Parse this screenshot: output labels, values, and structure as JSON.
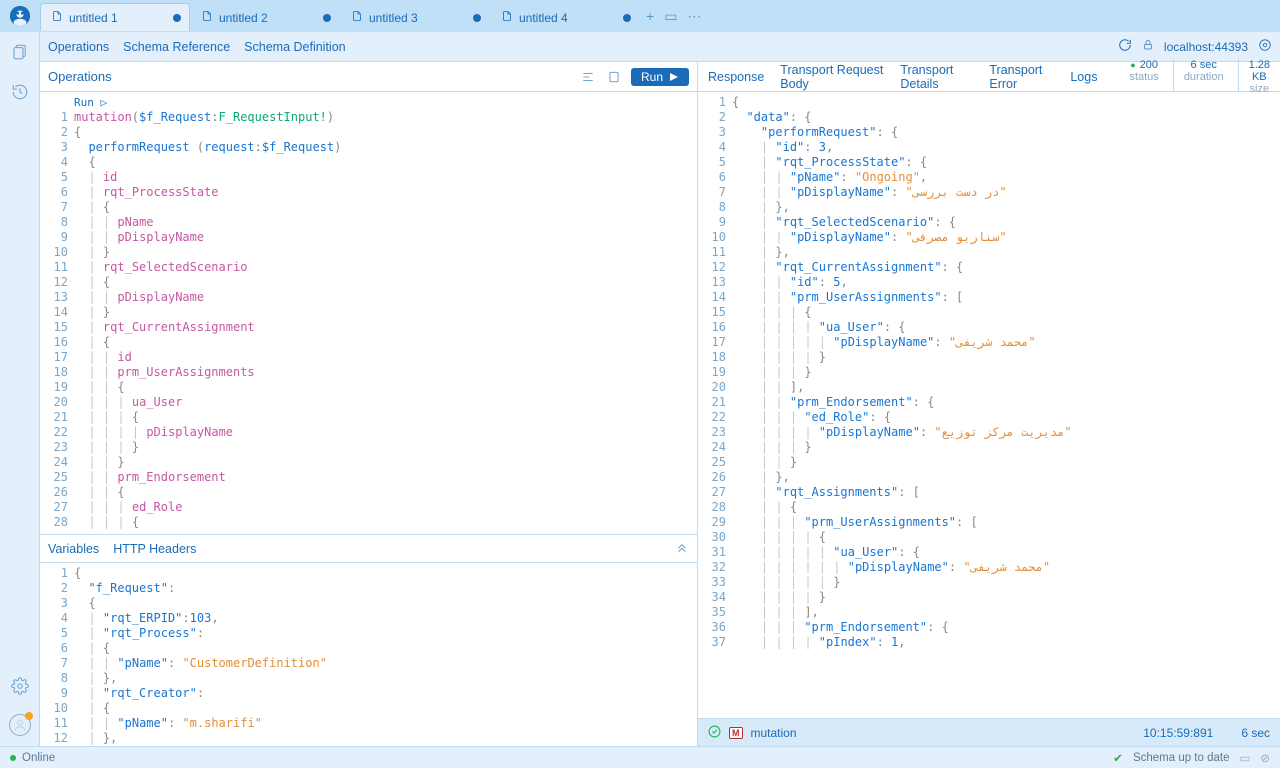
{
  "tabs": [
    {
      "label": "untitled 1",
      "active": true
    },
    {
      "label": "untitled 2",
      "active": false
    },
    {
      "label": "untitled 3",
      "active": false
    },
    {
      "label": "untitled 4",
      "active": false
    }
  ],
  "schemaBar": {
    "items": [
      "Operations",
      "Schema Reference",
      "Schema Definition"
    ],
    "url": "localhost:44393"
  },
  "ops": {
    "title": "Operations",
    "runLabel": "Run",
    "runHint": "Run ▷",
    "code_lines": [
      {
        "html": "<span class='kw'>mutation</span><span class='punct'>(</span><span class='field'>$f_Request</span><span class='punct'>:</span><span class='type'>F_RequestInput!</span><span class='punct'>)</span>"
      },
      {
        "html": "<span class='punct'>{</span>"
      },
      {
        "html": "  <span class='field'>performRequest</span> <span class='punct'>(</span><span class='field'>request</span><span class='punct'>:</span><span class='field'>$f_Request</span><span class='punct'>)</span>"
      },
      {
        "html": "  <span class='punct'>{</span>"
      },
      {
        "html": "  <span class='bar'>|</span> <span class='prop'>id</span>"
      },
      {
        "html": "  <span class='bar'>|</span> <span class='prop'>rqt_ProcessState</span>"
      },
      {
        "html": "  <span class='bar'>|</span> <span class='punct'>{</span>"
      },
      {
        "html": "  <span class='bar'>|</span> <span class='bar'>|</span> <span class='prop'>pName</span>"
      },
      {
        "html": "  <span class='bar'>|</span> <span class='bar'>|</span> <span class='prop'>pDisplayName</span>"
      },
      {
        "html": "  <span class='bar'>|</span> <span class='punct'>}</span>"
      },
      {
        "html": "  <span class='bar'>|</span> <span class='prop'>rqt_SelectedScenario</span>"
      },
      {
        "html": "  <span class='bar'>|</span> <span class='punct'>{</span>"
      },
      {
        "html": "  <span class='bar'>|</span> <span class='bar'>|</span> <span class='prop'>pDisplayName</span>"
      },
      {
        "html": "  <span class='bar'>|</span> <span class='punct'>}</span>"
      },
      {
        "html": "  <span class='bar'>|</span> <span class='prop'>rqt_CurrentAssignment</span>"
      },
      {
        "html": "  <span class='bar'>|</span> <span class='punct'>{</span>"
      },
      {
        "html": "  <span class='bar'>|</span> <span class='bar'>|</span> <span class='prop'>id</span>"
      },
      {
        "html": "  <span class='bar'>|</span> <span class='bar'>|</span> <span class='prop'>prm_UserAssignments</span>"
      },
      {
        "html": "  <span class='bar'>|</span> <span class='bar'>|</span> <span class='punct'>{</span>"
      },
      {
        "html": "  <span class='bar'>|</span> <span class='bar'>|</span> <span class='bar'>|</span> <span class='prop'>ua_User</span>"
      },
      {
        "html": "  <span class='bar'>|</span> <span class='bar'>|</span> <span class='bar'>|</span> <span class='punct'>{</span>"
      },
      {
        "html": "  <span class='bar'>|</span> <span class='bar'>|</span> <span class='bar'>|</span> <span class='bar'>|</span> <span class='prop'>pDisplayName</span>"
      },
      {
        "html": "  <span class='bar'>|</span> <span class='bar'>|</span> <span class='bar'>|</span> <span class='punct'>}</span>"
      },
      {
        "html": "  <span class='bar'>|</span> <span class='bar'>|</span> <span class='punct'>}</span>"
      },
      {
        "html": "  <span class='bar'>|</span> <span class='bar'>|</span> <span class='prop'>prm_Endorsement</span>"
      },
      {
        "html": "  <span class='bar'>|</span> <span class='bar'>|</span> <span class='punct'>{</span>"
      },
      {
        "html": "  <span class='bar'>|</span> <span class='bar'>|</span> <span class='bar'>|</span> <span class='prop'>ed_Role</span>"
      },
      {
        "html": "  <span class='bar'>|</span> <span class='bar'>|</span> <span class='bar'>|</span> <span class='punct'>{</span>"
      }
    ]
  },
  "vars": {
    "tabs": [
      "Variables",
      "HTTP Headers"
    ],
    "code_lines": [
      {
        "html": "<span class='punct'>{</span>"
      },
      {
        "html": "  <span class='key'>\"f_Request\"</span><span class='punct'>:</span>"
      },
      {
        "html": "  <span class='punct'>{</span>"
      },
      {
        "html": "  <span class='bar'>|</span> <span class='key'>\"rqt_ERPID\"</span><span class='punct'>:</span><span class='num'>103</span><span class='punct'>,</span>"
      },
      {
        "html": "  <span class='bar'>|</span> <span class='key'>\"rqt_Process\"</span><span class='punct'>:</span>"
      },
      {
        "html": "  <span class='bar'>|</span> <span class='punct'>{</span>"
      },
      {
        "html": "  <span class='bar'>|</span> <span class='bar'>|</span> <span class='key'>\"pName\"</span><span class='punct'>:</span> <span class='str'>\"CustomerDefinition\"</span>"
      },
      {
        "html": "  <span class='bar'>|</span> <span class='punct'>},</span>"
      },
      {
        "html": "  <span class='bar'>|</span> <span class='key'>\"rqt_Creator\"</span><span class='punct'>:</span>"
      },
      {
        "html": "  <span class='bar'>|</span> <span class='punct'>{</span>"
      },
      {
        "html": "  <span class='bar'>|</span> <span class='bar'>|</span> <span class='key'>\"pName\"</span><span class='punct'>:</span> <span class='str'>\"m.sharifi\"</span>"
      },
      {
        "html": "  <span class='bar'>|</span> <span class='punct'>},</span>"
      }
    ]
  },
  "resp": {
    "tabs": [
      "Response",
      "Transport Request Body",
      "Transport Details",
      "Transport Error",
      "Logs"
    ],
    "stats": {
      "status": "200",
      "duration": "6 sec",
      "size": "1.28 KB",
      "statusLbl": "status",
      "durationLbl": "duration",
      "sizeLbl": "size"
    },
    "code_lines": [
      {
        "html": "<span class='punct'>{</span>"
      },
      {
        "html": "  <span class='key'>\"data\"</span><span class='punct'>:</span> <span class='punct'>{</span>"
      },
      {
        "html": "    <span class='key'>\"performRequest\"</span><span class='punct'>:</span> <span class='punct'>{</span>"
      },
      {
        "html": "    <span class='bar'>|</span> <span class='key'>\"id\"</span><span class='punct'>:</span> <span class='num'>3</span><span class='punct'>,</span>"
      },
      {
        "html": "    <span class='bar'>|</span> <span class='key'>\"rqt_ProcessState\"</span><span class='punct'>:</span> <span class='punct'>{</span>"
      },
      {
        "html": "    <span class='bar'>|</span> <span class='bar'>|</span> <span class='key'>\"pName\"</span><span class='punct'>:</span> <span class='str'>\"Ongoing\"</span><span class='punct'>,</span>"
      },
      {
        "html": "    <span class='bar'>|</span> <span class='bar'>|</span> <span class='key'>\"pDisplayName\"</span><span class='punct'>:</span> <span class='str'>\"در دست بررسی\"</span>"
      },
      {
        "html": "    <span class='bar'>|</span> <span class='punct'>},</span>"
      },
      {
        "html": "    <span class='bar'>|</span> <span class='key'>\"rqt_SelectedScenario\"</span><span class='punct'>:</span> <span class='punct'>{</span>"
      },
      {
        "html": "    <span class='bar'>|</span> <span class='bar'>|</span> <span class='key'>\"pDisplayName\"</span><span class='punct'>:</span> <span class='str'>\"سناریو مصرفی\"</span>"
      },
      {
        "html": "    <span class='bar'>|</span> <span class='punct'>},</span>"
      },
      {
        "html": "    <span class='bar'>|</span> <span class='key'>\"rqt_CurrentAssignment\"</span><span class='punct'>:</span> <span class='punct'>{</span>"
      },
      {
        "html": "    <span class='bar'>|</span> <span class='bar'>|</span> <span class='key'>\"id\"</span><span class='punct'>:</span> <span class='num'>5</span><span class='punct'>,</span>"
      },
      {
        "html": "    <span class='bar'>|</span> <span class='bar'>|</span> <span class='key'>\"prm_UserAssignments\"</span><span class='punct'>:</span> <span class='punct'>[</span>"
      },
      {
        "html": "    <span class='bar'>|</span> <span class='bar'>|</span> <span class='bar'>|</span> <span class='punct'>{</span>"
      },
      {
        "html": "    <span class='bar'>|</span> <span class='bar'>|</span> <span class='bar'>|</span> <span class='bar'>|</span> <span class='key'>\"ua_User\"</span><span class='punct'>:</span> <span class='punct'>{</span>"
      },
      {
        "html": "    <span class='bar'>|</span> <span class='bar'>|</span> <span class='bar'>|</span> <span class='bar'>|</span> <span class='bar'>|</span> <span class='key'>\"pDisplayName\"</span><span class='punct'>:</span> <span class='str'>\"محمد شریفی\"</span>"
      },
      {
        "html": "    <span class='bar'>|</span> <span class='bar'>|</span> <span class='bar'>|</span> <span class='bar'>|</span> <span class='punct'>}</span>"
      },
      {
        "html": "    <span class='bar'>|</span> <span class='bar'>|</span> <span class='bar'>|</span> <span class='punct'>}</span>"
      },
      {
        "html": "    <span class='bar'>|</span> <span class='bar'>|</span> <span class='punct'>],</span>"
      },
      {
        "html": "    <span class='bar'>|</span> <span class='bar'>|</span> <span class='key'>\"prm_Endorsement\"</span><span class='punct'>:</span> <span class='punct'>{</span>"
      },
      {
        "html": "    <span class='bar'>|</span> <span class='bar'>|</span> <span class='bar'>|</span> <span class='key'>\"ed_Role\"</span><span class='punct'>:</span> <span class='punct'>{</span>"
      },
      {
        "html": "    <span class='bar'>|</span> <span class='bar'>|</span> <span class='bar'>|</span> <span class='bar'>|</span> <span class='key'>\"pDisplayName\"</span><span class='punct'>:</span> <span class='str'>\"مدیریت مرکز توزیع\"</span>"
      },
      {
        "html": "    <span class='bar'>|</span> <span class='bar'>|</span> <span class='bar'>|</span> <span class='punct'>}</span>"
      },
      {
        "html": "    <span class='bar'>|</span> <span class='bar'>|</span> <span class='punct'>}</span>"
      },
      {
        "html": "    <span class='bar'>|</span> <span class='punct'>},</span>"
      },
      {
        "html": "    <span class='bar'>|</span> <span class='key'>\"rqt_Assignments\"</span><span class='punct'>:</span> <span class='punct'>[</span>"
      },
      {
        "html": "    <span class='bar'>|</span> <span class='bar'>|</span> <span class='punct'>{</span>"
      },
      {
        "html": "    <span class='bar'>|</span> <span class='bar'>|</span> <span class='bar'>|</span> <span class='key'>\"prm_UserAssignments\"</span><span class='punct'>:</span> <span class='punct'>[</span>"
      },
      {
        "html": "    <span class='bar'>|</span> <span class='bar'>|</span> <span class='bar'>|</span> <span class='bar'>|</span> <span class='punct'>{</span>"
      },
      {
        "html": "    <span class='bar'>|</span> <span class='bar'>|</span> <span class='bar'>|</span> <span class='bar'>|</span> <span class='bar'>|</span> <span class='key'>\"ua_User\"</span><span class='punct'>:</span> <span class='punct'>{</span>"
      },
      {
        "html": "    <span class='bar'>|</span> <span class='bar'>|</span> <span class='bar'>|</span> <span class='bar'>|</span> <span class='bar'>|</span> <span class='bar'>|</span> <span class='key'>\"pDisplayName\"</span><span class='punct'>:</span> <span class='str'>\"محمد شریفی\"</span>"
      },
      {
        "html": "    <span class='bar'>|</span> <span class='bar'>|</span> <span class='bar'>|</span> <span class='bar'>|</span> <span class='bar'>|</span> <span class='punct'>}</span>"
      },
      {
        "html": "    <span class='bar'>|</span> <span class='bar'>|</span> <span class='bar'>|</span> <span class='bar'>|</span> <span class='punct'>}</span>"
      },
      {
        "html": "    <span class='bar'>|</span> <span class='bar'>|</span> <span class='bar'>|</span> <span class='punct'>],</span>"
      },
      {
        "html": "    <span class='bar'>|</span> <span class='bar'>|</span> <span class='bar'>|</span> <span class='key'>\"prm_Endorsement\"</span><span class='punct'>:</span> <span class='punct'>{</span>"
      },
      {
        "html": "    <span class='bar'>|</span> <span class='bar'>|</span> <span class='bar'>|</span> <span class='bar'>|</span> <span class='key'>\"pIndex\"</span><span class='punct'>:</span> <span class='num'>1</span><span class='punct'>,</span>"
      }
    ]
  },
  "history": {
    "label": "mutation",
    "time": "10:15:59:891",
    "dur": "6 sec"
  },
  "footer": {
    "online": "Online",
    "schema": "Schema up to date"
  }
}
